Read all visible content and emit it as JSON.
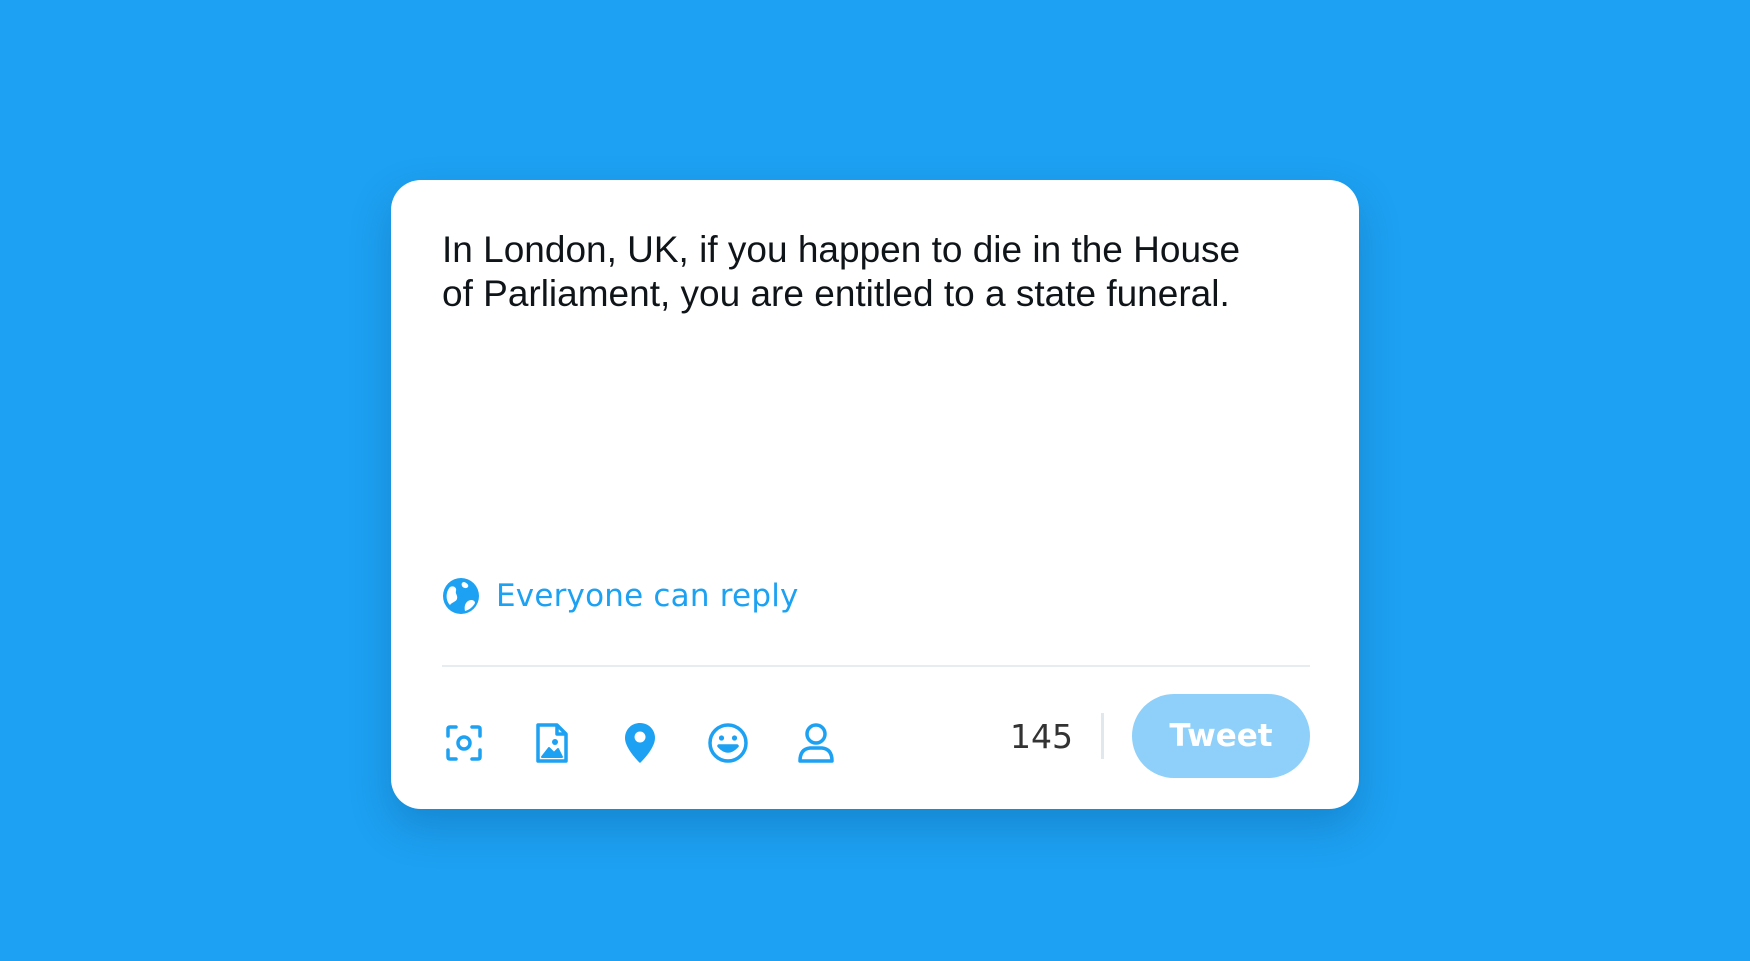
{
  "compose": {
    "text": "In London, UK, if you happen to die in the House\nof Parliament, you are entitled to a state funeral.",
    "reply_setting_label": "Everyone can reply",
    "reply_setting_icon": "globe-icon",
    "char_count": "145",
    "tweet_button_label": "Tweet",
    "toolbar_icons": [
      "camera-scan-icon",
      "image-file-icon",
      "location-pin-icon",
      "emoji-icon",
      "person-icon"
    ]
  },
  "colors": {
    "background": "#1DA1F2",
    "accent": "#1DA1F2",
    "button_disabled": "#8ED0F9",
    "text": "#0f1419"
  }
}
